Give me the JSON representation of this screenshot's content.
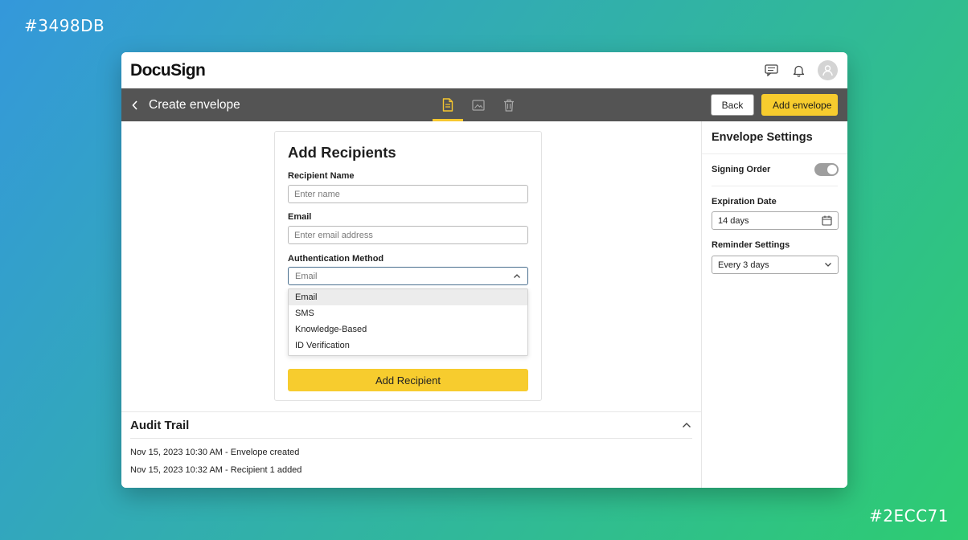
{
  "corner_labels": {
    "top_left": "#3498DB",
    "bottom_right": "#2ECC71"
  },
  "colors": {
    "accent": "#F7CC2E",
    "toolbar": "#545454",
    "gradient_start": "#3498DB",
    "gradient_end": "#2ECC71"
  },
  "header": {
    "logo": "DocuSign",
    "icons": [
      "message-icon",
      "bell-icon",
      "user-avatar"
    ]
  },
  "toolbar": {
    "title": "Create envelope",
    "tabs": [
      "document-icon",
      "image-icon",
      "trash-icon"
    ],
    "back_label": "Back",
    "add_envelope_label": "Add envelope"
  },
  "recipients_form": {
    "title": "Add Recipients",
    "name_label": "Recipient Name",
    "name_placeholder": "Enter name",
    "email_label": "Email",
    "email_placeholder": "Enter email address",
    "auth_label": "Authentication Method",
    "auth_selected": "Email",
    "auth_options": [
      "Email",
      "SMS",
      "Knowledge-Based",
      "ID Verification"
    ],
    "submit_label": "Add Recipient"
  },
  "audit_trail": {
    "title": "Audit Trail",
    "entries": [
      "Nov 15, 2023 10:30 AM - Envelope created",
      "Nov 15, 2023 10:32 AM - Recipient 1 added"
    ]
  },
  "settings": {
    "title": "Envelope Settings",
    "signing_order_label": "Signing Order",
    "signing_order_enabled": false,
    "expiration_label": "Expiration Date",
    "expiration_value": "14 days",
    "reminder_label": "Reminder Settings",
    "reminder_value": "Every 3 days"
  }
}
